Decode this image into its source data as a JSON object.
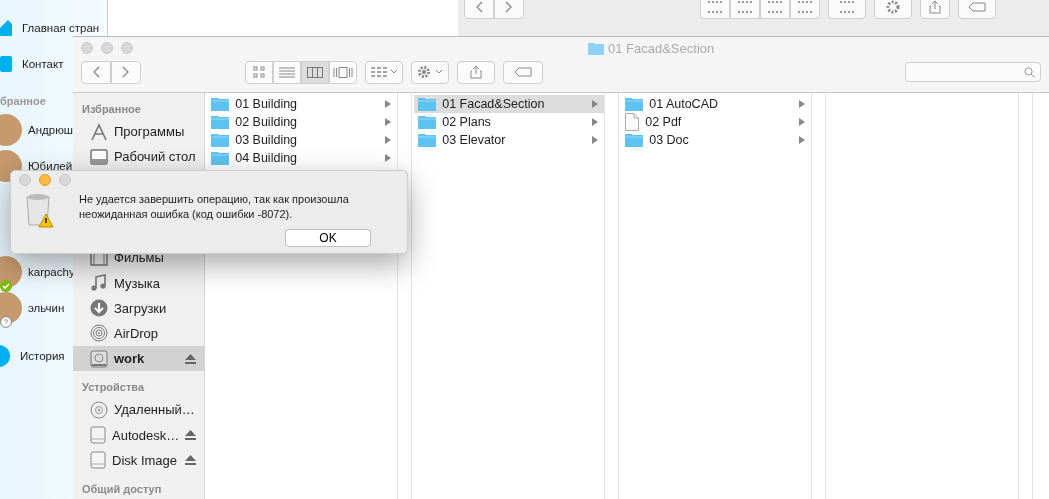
{
  "skype": {
    "nav": [
      {
        "label": "Главная стран",
        "kind": "home"
      },
      {
        "label": "Контакт",
        "kind": "contacts"
      }
    ],
    "section": "бранное",
    "contacts": [
      {
        "name": "Андрюш",
        "kind": "plain"
      },
      {
        "name": "Юбилей",
        "kind": "plain"
      },
      {
        "name": "karpachy",
        "kind": "online"
      },
      {
        "name": "эльчин",
        "kind": "unknown"
      }
    ],
    "history": "История"
  },
  "finder": {
    "title": "01 Facad&Section",
    "views": [
      {
        "kind": "icons",
        "selected": false
      },
      {
        "kind": "list",
        "selected": false
      },
      {
        "kind": "columns",
        "selected": true
      },
      {
        "kind": "cover",
        "selected": false
      }
    ],
    "sidebar": [
      {
        "title": "Избранное",
        "items": [
          {
            "label": "Программы",
            "kind": "apps",
            "selected": false,
            "eject": false
          },
          {
            "label": "Рабочий стол",
            "kind": "desktop",
            "selected": false,
            "eject": false
          },
          {
            "label": "Фильмы",
            "kind": "movies",
            "selected": false,
            "eject": false
          },
          {
            "label": "Музыка",
            "kind": "music",
            "selected": false,
            "eject": false
          },
          {
            "label": "Загрузки",
            "kind": "downloads",
            "selected": false,
            "eject": false
          },
          {
            "label": "AirDrop",
            "kind": "airdrop",
            "selected": false,
            "eject": false
          },
          {
            "label": "work",
            "kind": "drive",
            "selected": true,
            "eject": true
          }
        ]
      },
      {
        "title": "Устройства",
        "items": [
          {
            "label": "Удаленный…",
            "kind": "disc",
            "selected": false,
            "eject": false
          },
          {
            "label": "Autodesk…",
            "kind": "disk",
            "selected": false,
            "eject": true
          },
          {
            "label": "Disk Image",
            "kind": "disk",
            "selected": false,
            "eject": true
          }
        ]
      },
      {
        "title": "Общий доступ"
      }
    ],
    "columns": [
      {
        "items": [
          {
            "name": "01 Building",
            "kind": "folder",
            "selected": false
          },
          {
            "name": "02 Building",
            "kind": "folder",
            "selected": false
          },
          {
            "name": "03 Building",
            "kind": "folder",
            "selected": false
          },
          {
            "name": "04 Building",
            "kind": "folder",
            "selected": false
          }
        ]
      },
      {
        "items": [
          {
            "name": "01 Facad&Section",
            "kind": "folder",
            "selected": true
          },
          {
            "name": "02 Plans",
            "kind": "folder",
            "selected": false
          },
          {
            "name": "03 Elevator",
            "kind": "folder",
            "selected": false
          }
        ]
      },
      {
        "items": [
          {
            "name": "01 AutoCAD",
            "kind": "folder",
            "selected": false
          },
          {
            "name": "02 Pdf",
            "kind": "file",
            "selected": false
          },
          {
            "name": "03 Doc",
            "kind": "folder",
            "selected": false
          }
        ]
      }
    ]
  },
  "dialog": {
    "message": "Не удается завершить операцию, так как произошла неожиданная ошибка (код ошибки -8072).",
    "button": "OK"
  }
}
